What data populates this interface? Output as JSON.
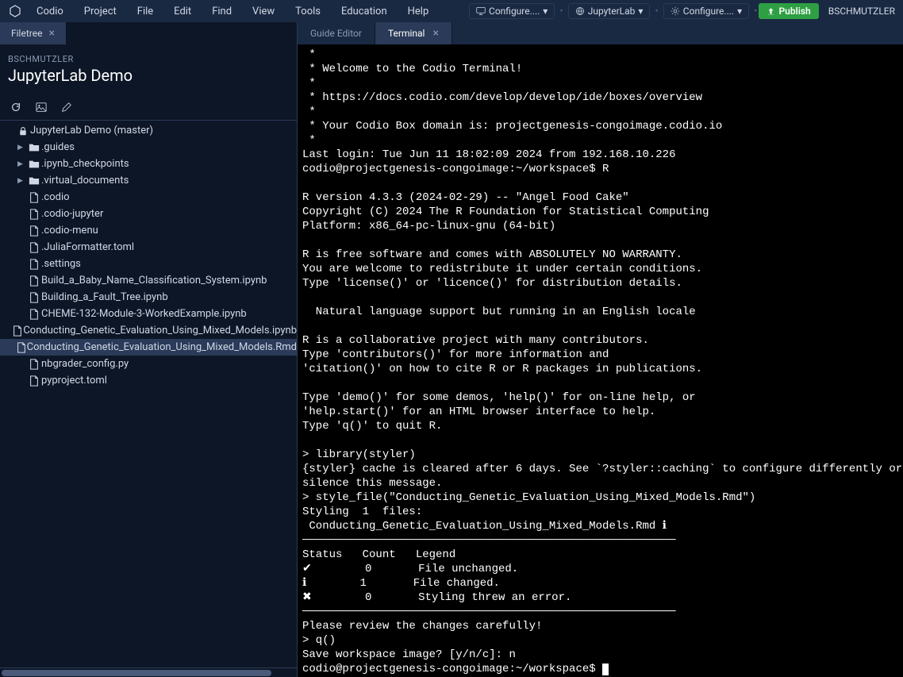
{
  "menubar": {
    "app": "Codio",
    "items": [
      "Project",
      "File",
      "Edit",
      "Find",
      "View",
      "Tools",
      "Education",
      "Help"
    ],
    "configs": [
      {
        "icon": "monitor-icon",
        "label": "Configure...."
      },
      {
        "icon": "globe-icon",
        "label": "JupyterLab"
      },
      {
        "icon": "gear-icon",
        "label": "Configure...."
      }
    ],
    "publish": "Publish",
    "username": "BSCHMUTZLER"
  },
  "sidebar": {
    "tab": "Filetree",
    "owner": "BSCHMUTZLER",
    "project": "JupyterLab Demo",
    "root": "JupyterLab Demo (master)",
    "tree": [
      {
        "depth": 0,
        "type": "root",
        "label": "JupyterLab Demo (master)",
        "icon": "lock-icon"
      },
      {
        "depth": 1,
        "type": "folder",
        "label": ".guides",
        "expand": true
      },
      {
        "depth": 1,
        "type": "folder",
        "label": ".ipynb_checkpoints",
        "expand": true
      },
      {
        "depth": 1,
        "type": "folder",
        "label": ".virtual_documents",
        "expand": true
      },
      {
        "depth": 1,
        "type": "file",
        "label": ".codio"
      },
      {
        "depth": 1,
        "type": "file",
        "label": ".codio-jupyter"
      },
      {
        "depth": 1,
        "type": "file",
        "label": ".codio-menu"
      },
      {
        "depth": 1,
        "type": "file",
        "label": ".JuliaFormatter.toml"
      },
      {
        "depth": 1,
        "type": "file",
        "label": ".settings"
      },
      {
        "depth": 1,
        "type": "file",
        "label": "Build_a_Baby_Name_Classification_System.ipynb"
      },
      {
        "depth": 1,
        "type": "file",
        "label": "Building_a_Fault_Tree.ipynb"
      },
      {
        "depth": 1,
        "type": "file",
        "label": "CHEME-132-Module-3-WorkedExample.ipynb"
      },
      {
        "depth": 1,
        "type": "file",
        "label": "Conducting_Genetic_Evaluation_Using_Mixed_Models.ipynb"
      },
      {
        "depth": 1,
        "type": "file",
        "label": "Conducting_Genetic_Evaluation_Using_Mixed_Models.Rmd",
        "selected": true
      },
      {
        "depth": 1,
        "type": "file",
        "label": "nbgrader_config.py"
      },
      {
        "depth": 1,
        "type": "file",
        "label": "pyproject.toml"
      }
    ]
  },
  "editor": {
    "tabs": [
      {
        "label": "Guide Editor",
        "active": false,
        "closable": false
      },
      {
        "label": "Terminal",
        "active": true,
        "closable": true
      }
    ]
  },
  "terminal": {
    "lines": [
      " *",
      " * Welcome to the Codio Terminal!",
      " *",
      " * https://docs.codio.com/develop/develop/ide/boxes/overview",
      " *",
      " * Your Codio Box domain is: projectgenesis-congoimage.codio.io",
      " *",
      "Last login: Tue Jun 11 18:02:09 2024 from 192.168.10.226",
      "codio@projectgenesis-congoimage:~/workspace$ R",
      "",
      "R version 4.3.3 (2024-02-29) -- \"Angel Food Cake\"",
      "Copyright (C) 2024 The R Foundation for Statistical Computing",
      "Platform: x86_64-pc-linux-gnu (64-bit)",
      "",
      "R is free software and comes with ABSOLUTELY NO WARRANTY.",
      "You are welcome to redistribute it under certain conditions.",
      "Type 'license()' or 'licence()' for distribution details.",
      "",
      "  Natural language support but running in an English locale",
      "",
      "R is a collaborative project with many contributors.",
      "Type 'contributors()' for more information and",
      "'citation()' on how to cite R or R packages in publications.",
      "",
      "Type 'demo()' for some demos, 'help()' for on-line help, or",
      "'help.start()' for an HTML browser interface to help.",
      "Type 'q()' to quit R.",
      "",
      "> library(styler)",
      "{styler} cache is cleared after 6 days. See `?styler::caching` to configure differently or",
      "silence this message.",
      "> style_file(\"Conducting_Genetic_Evaluation_Using_Mixed_Models.Rmd\")",
      "Styling  1  files:",
      " Conducting_Genetic_Evaluation_Using_Mixed_Models.Rmd ℹ",
      "────────────────────────────────────────────────────────",
      "Status   Count   Legend",
      "✔        0       File unchanged.",
      "ℹ        1       File changed.",
      "✖        0       Styling threw an error.",
      "────────────────────────────────────────────────────────",
      "Please review the changes carefully!",
      "> q()",
      "Save workspace image? [y/n/c]: n",
      "codio@projectgenesis-congoimage:~/workspace$ "
    ]
  }
}
